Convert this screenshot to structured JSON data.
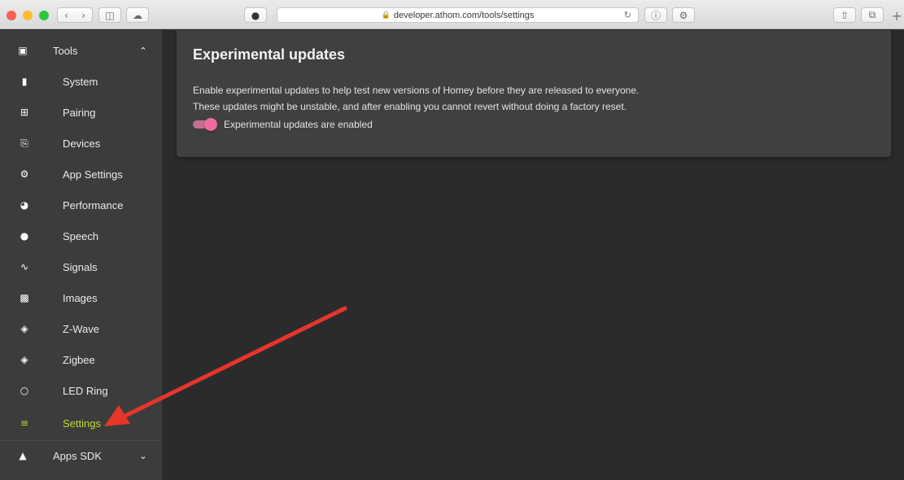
{
  "browser": {
    "url": "developer.athom.com/tools/settings",
    "traffic_lights": [
      "#fc5f57",
      "#fdbc2e",
      "#28c840"
    ]
  },
  "sidebar": {
    "tools_section": {
      "label": "Tools",
      "icon": "toolbox-icon",
      "expanded": true
    },
    "items": [
      {
        "label": "System",
        "icon": "chip-icon"
      },
      {
        "label": "Pairing",
        "icon": "plus-square-icon"
      },
      {
        "label": "Devices",
        "icon": "plug-icon"
      },
      {
        "label": "App Settings",
        "icon": "gear-icon"
      },
      {
        "label": "Performance",
        "icon": "gauge-icon"
      },
      {
        "label": "Speech",
        "icon": "speech-bubbles-icon"
      },
      {
        "label": "Signals",
        "icon": "wave-icon"
      },
      {
        "label": "Images",
        "icon": "images-icon"
      },
      {
        "label": "Z-Wave",
        "icon": "wifi-icon"
      },
      {
        "label": "Zigbee",
        "icon": "wifi-icon"
      },
      {
        "label": "LED Ring",
        "icon": "ring-icon"
      },
      {
        "label": "Settings",
        "icon": "sliders-icon",
        "active": true
      }
    ],
    "apps_section": {
      "label": "Apps SDK",
      "icon": "shapes-icon",
      "expanded": false
    },
    "active_color": "#c4d92c"
  },
  "main": {
    "card": {
      "title": "Experimental updates",
      "description_line1": "Enable experimental updates to help test new versions of Homey before they are released to everyone.",
      "description_line2": "These updates might be unstable, and after enabling you cannot revert without doing a factory reset.",
      "toggle_label": "Experimental updates are enabled",
      "toggle_on": true,
      "toggle_color": "#f06aa0"
    }
  },
  "annotation": {
    "arrow_color": "#e8352a"
  }
}
